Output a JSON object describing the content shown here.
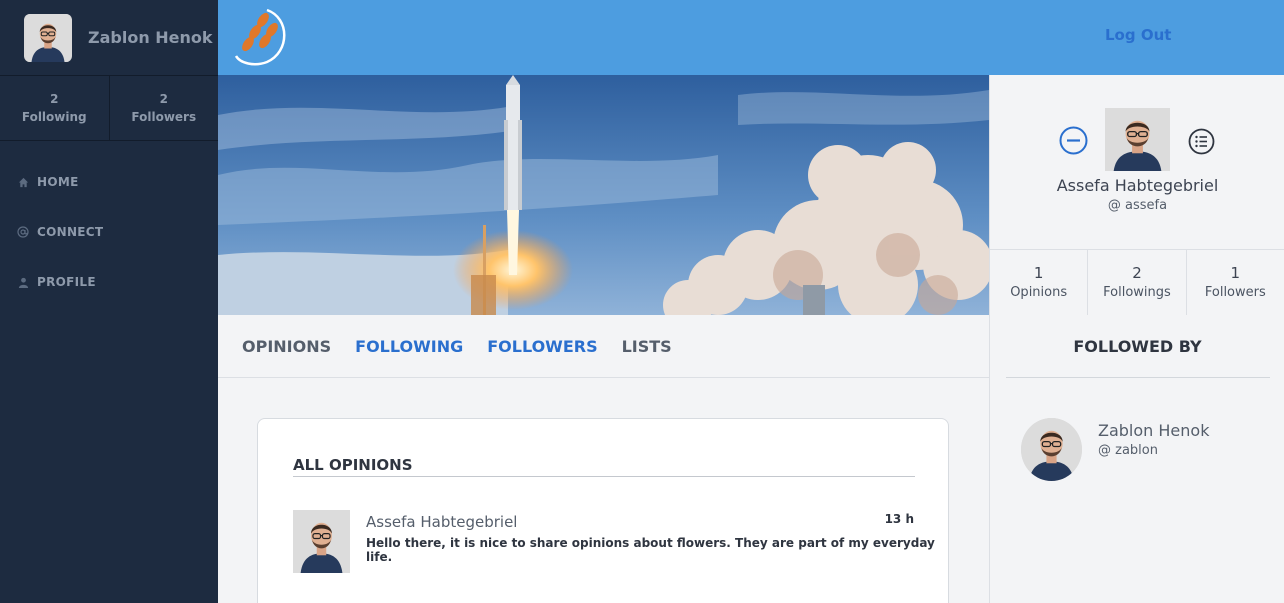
{
  "sidebar": {
    "user_name": "Zablon Henok",
    "stats": [
      {
        "value": "2",
        "label": "Following"
      },
      {
        "value": "2",
        "label": "Followers"
      }
    ],
    "nav": [
      {
        "label": "HOME",
        "icon": "home-icon"
      },
      {
        "label": "CONNECT",
        "icon": "at-icon"
      },
      {
        "label": "PROFILE",
        "icon": "user-icon"
      }
    ]
  },
  "topbar": {
    "logout_label": "Log Out",
    "logo_icon": "wheat-logo-icon"
  },
  "profile": {
    "name": "Assefa Habtegebriel",
    "handle": "@ assefa",
    "stats": [
      {
        "value": "1",
        "label": "Opinions"
      },
      {
        "value": "2",
        "label": "Followings"
      },
      {
        "value": "1",
        "label": "Followers"
      }
    ]
  },
  "tabs": [
    {
      "label": "OPINIONS",
      "active": false
    },
    {
      "label": "FOLLOWING",
      "active": true
    },
    {
      "label": "FOLLOWERS",
      "active": true
    },
    {
      "label": "LISTS",
      "active": false
    }
  ],
  "followed_by": {
    "title": "FOLLOWED BY",
    "users": [
      {
        "name": "Zablon Henok",
        "handle": "@ zablon"
      }
    ]
  },
  "opinions": {
    "title": "ALL OPINIONS",
    "items": [
      {
        "author": "Assefa Habtegebriel",
        "time": "13 h",
        "text": "Hello there, it is nice to share opinions about flowers. They are part of my everyday life."
      }
    ]
  },
  "colors": {
    "sidebar_bg": "#1d2b40",
    "topbar_bg": "#4d9de0",
    "accent": "#2a6fce",
    "logo_orange": "#e0782a"
  }
}
